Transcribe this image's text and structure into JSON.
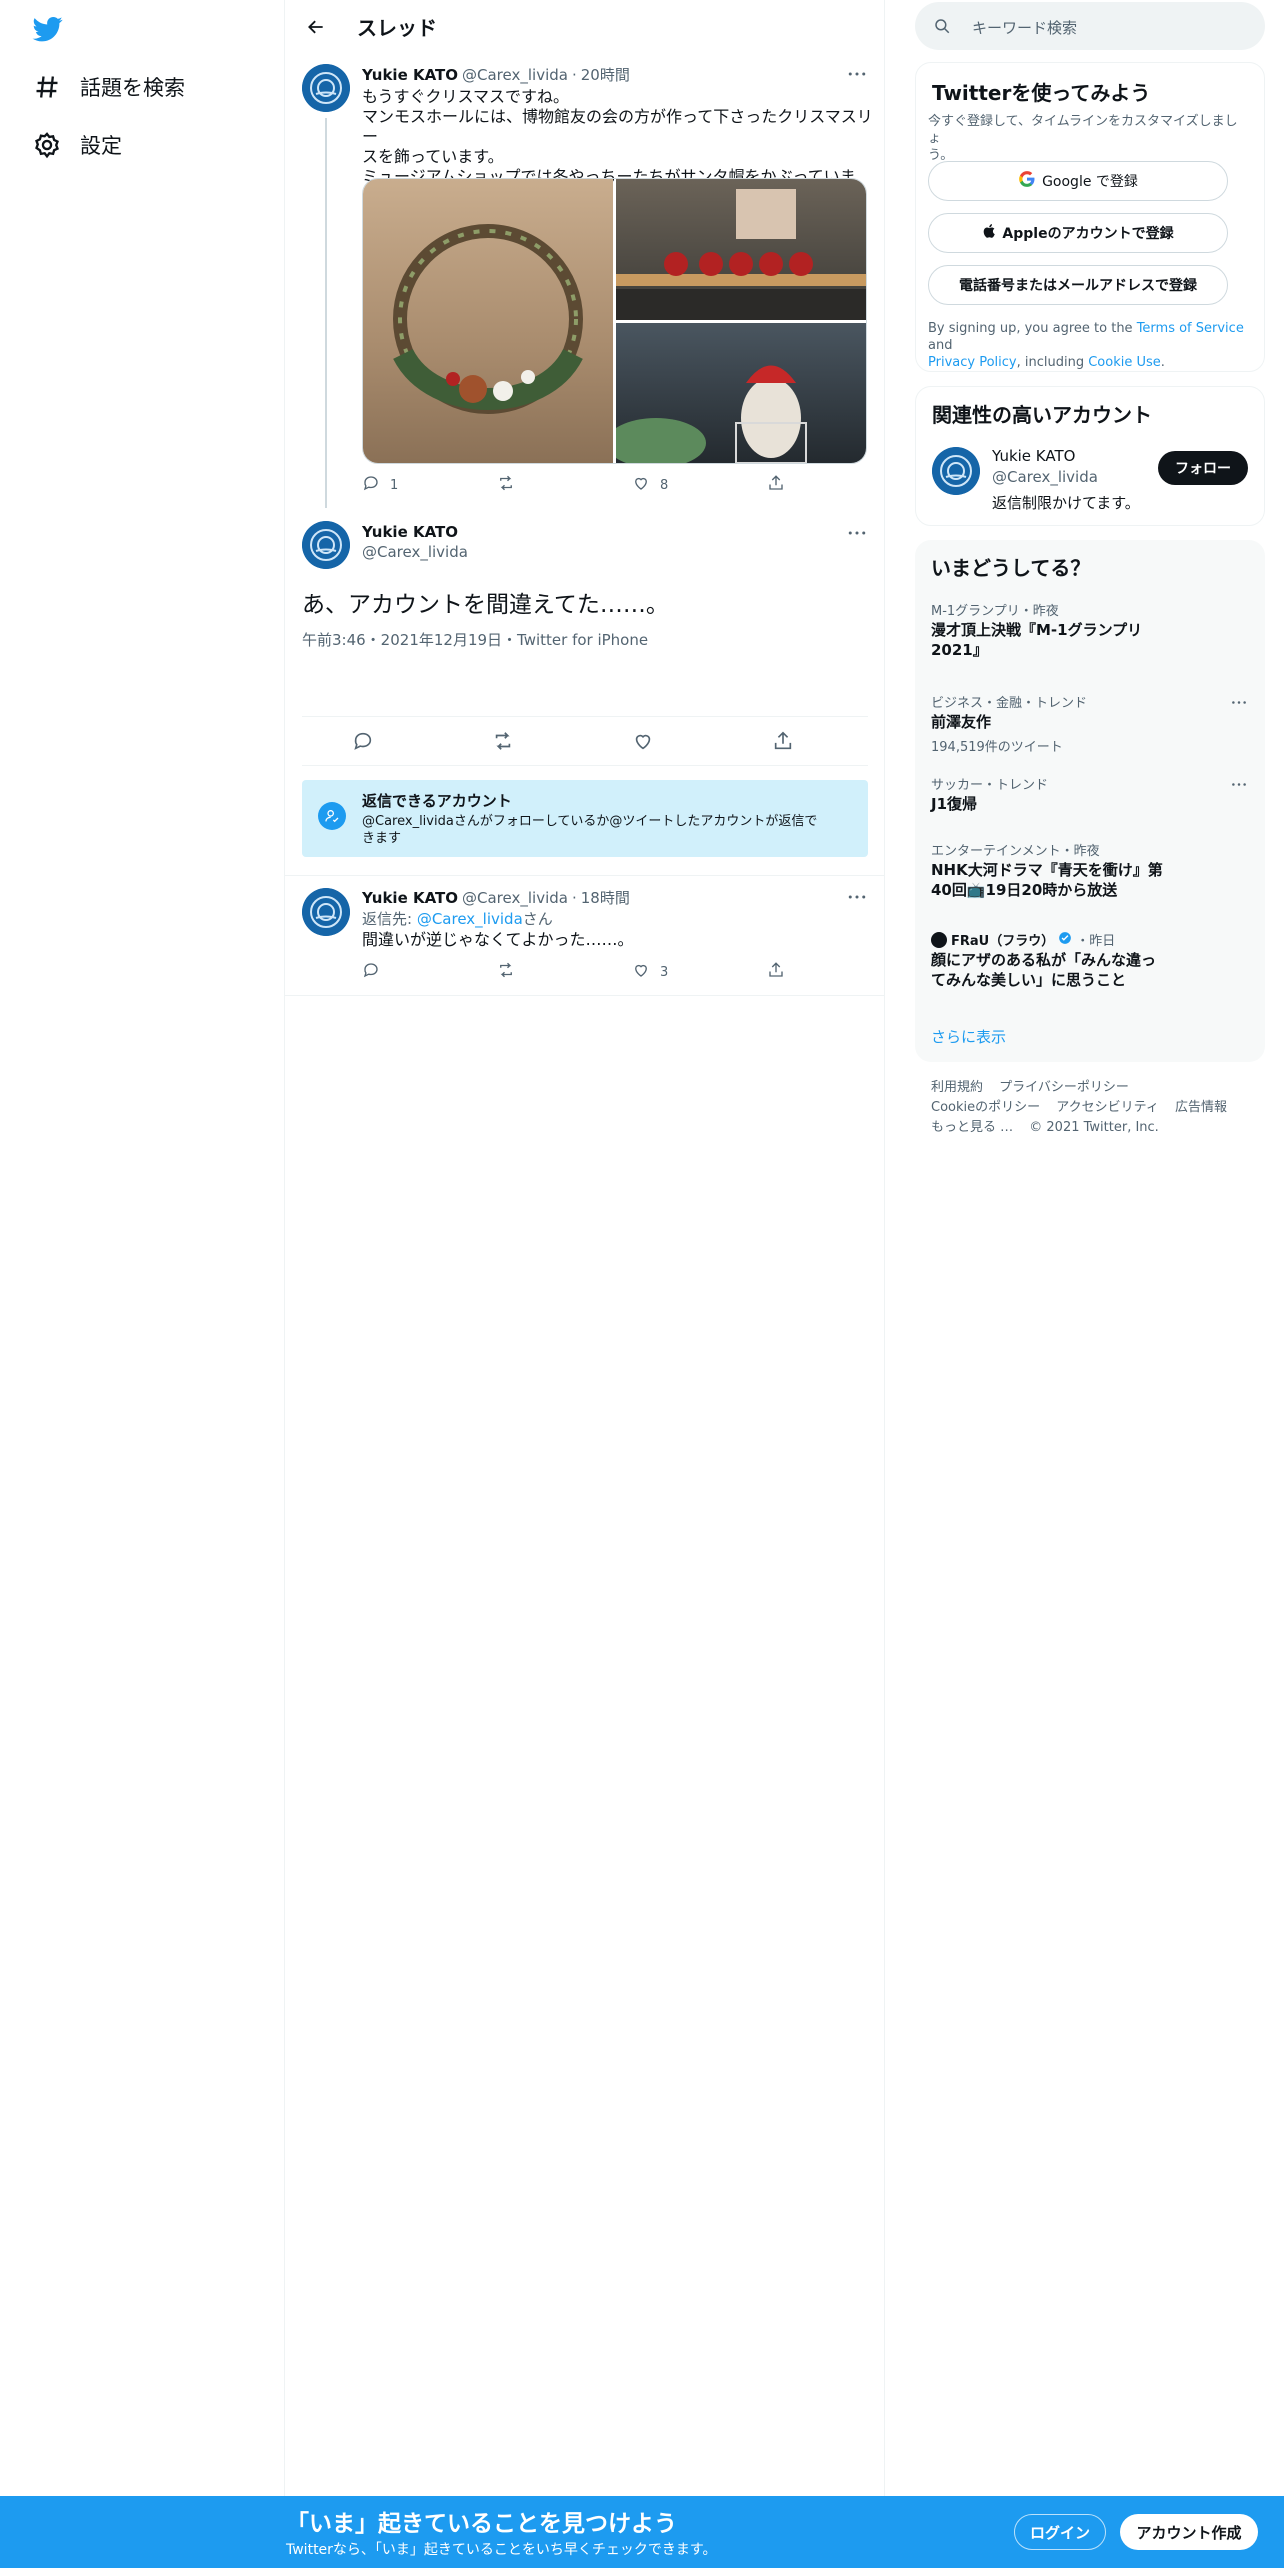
{
  "sidebar": {
    "items": [
      {
        "label": "話題を検索"
      },
      {
        "label": "設定"
      }
    ]
  },
  "header": {
    "title": "スレッド"
  },
  "tweet1": {
    "name": "Yukie KATO",
    "handle": "@Carex_livida",
    "time": "20時間",
    "lines": [
      "もうすぐクリスマスですね。",
      "マンモスホールには、博物館友の会の方が作って下さったクリスマスリー",
      "スを飾っています。",
      "ミュージアムショップでは冬やっちーたちがサンタ帽をかぶっています。"
    ],
    "reply_count": "1",
    "retweet_count": "",
    "like_count": "8"
  },
  "focus": {
    "name": "Yukie KATO",
    "handle": "@Carex_livida",
    "text": "あ、アカウントを間違えてた……。",
    "meta": "午前3:46・2021年12月19日・Twitter for iPhone"
  },
  "reply_notice": {
    "title": "返信できるアカウント",
    "line1": "@Carex_lividaさんがフォローしているか@ツイートしたアカウントが返信で",
    "line2": "きます"
  },
  "tweet2": {
    "name": "Yukie KATO",
    "handle": "@Carex_livida",
    "time": "18時間",
    "reply_to_prefix": "返信先: ",
    "reply_to_handle": "@Carex_livida",
    "reply_to_suffix": "さん",
    "text": "間違いが逆じゃなくてよかった……。",
    "like_count": "3"
  },
  "search": {
    "placeholder": "キーワード検索"
  },
  "signup": {
    "title": "Twitterを使ってみよう",
    "subtitle_line1": "今すぐ登録して、タイムラインをカスタマイズしましょ",
    "subtitle_line2": "う。",
    "google": "Google で登録",
    "apple": "Appleのアカウントで登録",
    "phone": "電話番号またはメールアドレスで登録",
    "terms_prefix": "By signing up, you agree to the ",
    "terms_link": "Terms of Service",
    "terms_and": " and",
    "privacy_link": "Privacy Policy",
    "including": ", including ",
    "cookie_link": "Cookie Use",
    "period": "."
  },
  "related": {
    "title": "関連性の高いアカウント",
    "name": "Yukie KATO",
    "handle": "@Carex_livida",
    "bio": "返信制限かけてます。",
    "follow": "フォロー"
  },
  "trends": {
    "title": "いまどうしてる？",
    "items": [
      {
        "meta": "M-1グランプリ・昨夜",
        "title1": "漫才頂上決戦『M-1グランプリ",
        "title2": "2021』",
        "count": ""
      },
      {
        "meta": "ビジネス・金融・トレンド",
        "title1": "前澤友作",
        "title2": "",
        "count": "194,519件のツイート"
      },
      {
        "meta": "サッカー・トレンド",
        "title1": "J1復帰",
        "title2": "",
        "count": ""
      },
      {
        "meta": "エンターテインメント・昨夜",
        "title1": "NHK大河ドラマ『青天を衝け』第",
        "title2": "40回📺19日20時から放送",
        "count": ""
      },
      {
        "meta_source": "FRaU（フラウ）",
        "meta_time": "・昨日",
        "title1": "顔にアザのある私が「みんな違っ",
        "title2": "てみんな美しい」に思うこと",
        "count": ""
      }
    ],
    "show_more": "さらに表示"
  },
  "footer": {
    "links_row1": [
      "利用規約",
      "プライバシーポリシー"
    ],
    "links_row2": [
      "Cookieのポリシー",
      "アクセシビリティ",
      "広告情報"
    ],
    "more": "もっと見る …",
    "copyright": "© 2021 Twitter, Inc."
  },
  "bottom": {
    "title": "「いま」起きていることを見つけよう",
    "subtitle": "Twitterなら、「いま」起きていることをいち早くチェックできます。",
    "login": "ログイン",
    "signup": "アカウント作成"
  },
  "colors": {
    "accent": "#1d9bf0",
    "dark": "#0f1419",
    "muted": "#536471",
    "notice_bg": "#d1f0fb"
  }
}
